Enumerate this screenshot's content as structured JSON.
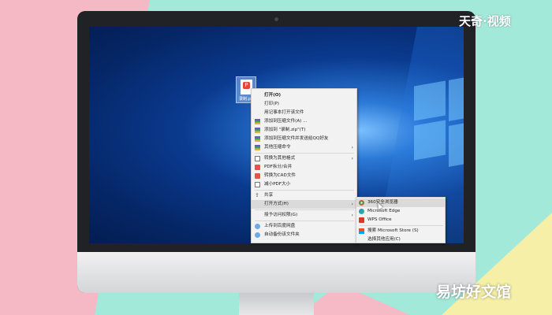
{
  "watermarks": {
    "top": "天奇·视频",
    "bottom": "易坊好文馆"
  },
  "desktop": {
    "file_icon_label": "录制.pdf",
    "file_icon_badge": "P"
  },
  "context_menu": {
    "items": [
      {
        "label": "打开(O)",
        "icon": "none",
        "bold": true
      },
      {
        "label": "打印(P)",
        "icon": "none"
      },
      {
        "label": "用记事本打开该文件",
        "icon": "none"
      },
      {
        "label": "添加到压缩文件(A) ...",
        "icon": "winrar-icon"
      },
      {
        "label": "添加到 \"录制.zip\"(T)",
        "icon": "winrar-icon"
      },
      {
        "label": "添加到压缩文件并发送给QQ好友",
        "icon": "winrar-icon"
      },
      {
        "label": "其他压缩命令",
        "icon": "winrar-icon",
        "submenu": true
      },
      {
        "label": "转换为其他格式",
        "icon": "document-icon",
        "submenu": true
      },
      {
        "label": "PDF拆分/合并",
        "icon": "pdf-icon"
      },
      {
        "label": "转换为CAD文件",
        "icon": "pdf-icon"
      },
      {
        "label": "减小PDF大小",
        "icon": "document-icon"
      },
      {
        "label": "共享",
        "icon": "share-icon"
      },
      {
        "label": "打开方式(H)",
        "icon": "none",
        "submenu": true,
        "highlighted": true
      },
      {
        "label": "授予访问权限(G)",
        "icon": "none",
        "submenu": true
      },
      {
        "label": "上传到百度网盘",
        "icon": "cloud-icon"
      },
      {
        "label": "自动备份该文件夹",
        "icon": "cloud-icon"
      }
    ]
  },
  "open_with_submenu": {
    "items": [
      {
        "label": "360安全浏览器",
        "icon": "360-browser-icon",
        "highlighted": true
      },
      {
        "label": "Microsoft Edge",
        "icon": "edge-icon"
      },
      {
        "label": "WPS Office",
        "icon": "wps-icon"
      },
      {
        "label": "搜索 Microsoft Store (S)",
        "icon": "store-icon"
      },
      {
        "label": "选择其他应用(C)",
        "icon": "none"
      }
    ]
  },
  "colors": {
    "menu_bg": "#f2f2f2",
    "menu_highlight": "#dadada",
    "desktop_blue": "#0a3a8f"
  }
}
